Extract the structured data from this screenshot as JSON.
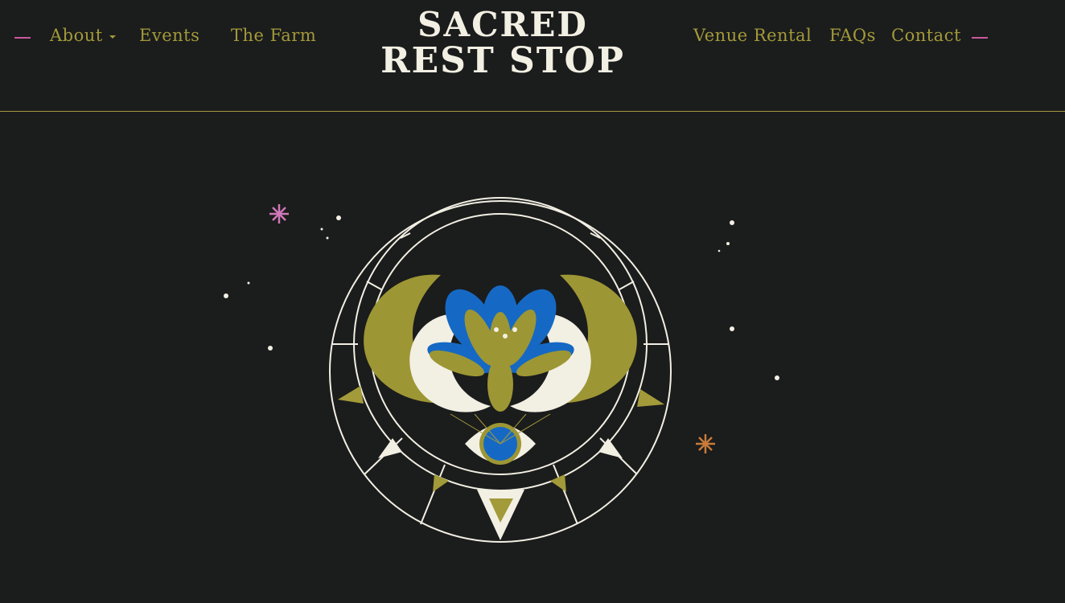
{
  "nav": {
    "left": [
      {
        "label": "About",
        "has_dropdown": true
      },
      {
        "label": "Events"
      },
      {
        "label": "The Farm"
      }
    ],
    "right": [
      {
        "label": "Venue Rental"
      },
      {
        "label": "FAQs"
      },
      {
        "label": "Contact"
      }
    ]
  },
  "logo": {
    "line1": "SACRED",
    "line2": "REST STOP"
  },
  "colors": {
    "background": "#1b1c1c",
    "accent_gold": "#a39a3a",
    "logo_cream": "#f2efe3",
    "dash_pink": "#c9589b",
    "lotus_blue": "#1569c4",
    "star_pink": "#d078b8",
    "star_orange": "#c87b3a"
  }
}
